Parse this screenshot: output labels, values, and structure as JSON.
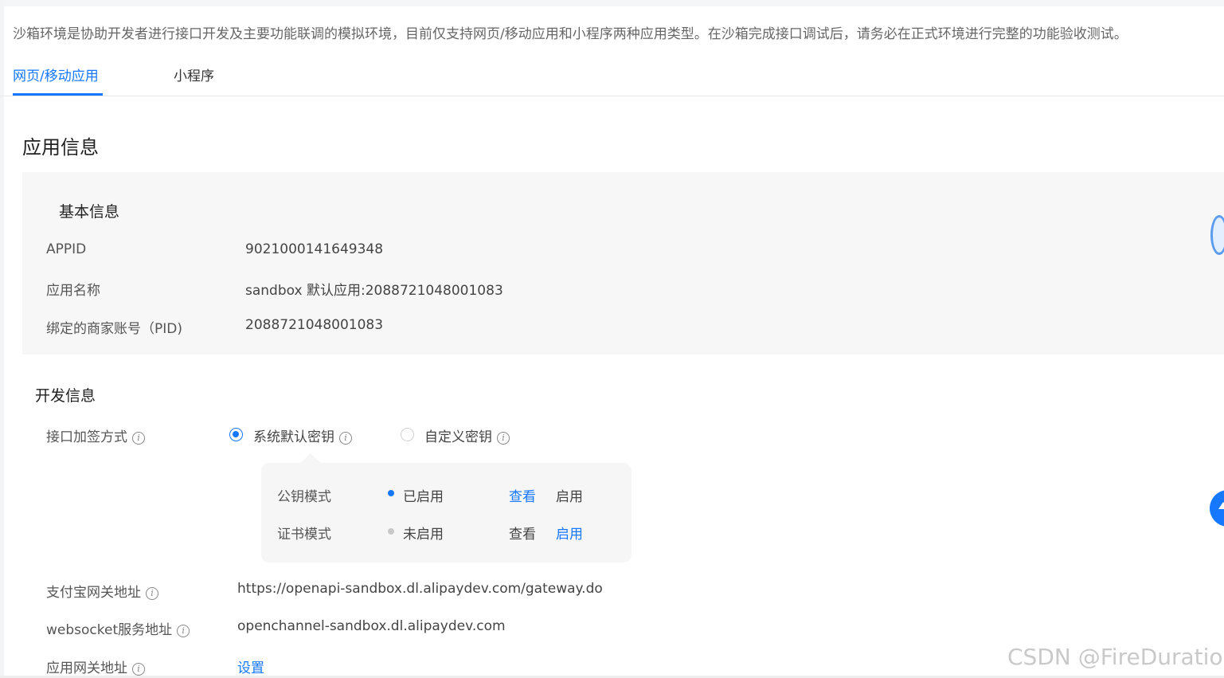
{
  "notice": "沙箱环境是协助开发者进行接口开发及主要功能联调的模拟环境，目前仅支持网页/移动应用和小程序两种应用类型。在沙箱完成接口调试后，请务必在正式环境进行完整的功能验收测试。",
  "tabs": [
    "网页/移动应用",
    "小程序"
  ],
  "app_info": {
    "title": "应用信息",
    "basic": {
      "title": "基本信息",
      "rows": [
        {
          "label": "APPID",
          "value": "9021000141649348"
        },
        {
          "label": "应用名称",
          "value": "sandbox 默认应用:2088721048001083"
        },
        {
          "label": "绑定的商家账号（PID)",
          "value": "2088721048001083"
        }
      ]
    }
  },
  "dev_info": {
    "title": "开发信息",
    "sign_method": {
      "label": "接口加签方式",
      "options": [
        {
          "label": "系统默认密钥",
          "checked": true
        },
        {
          "label": "自定义密钥",
          "checked": false
        }
      ]
    },
    "key_modes": [
      {
        "name": "公钥模式",
        "status": "已启用",
        "status_color": "#1677ff",
        "view": "查看",
        "enable": "启用"
      },
      {
        "name": "证书模式",
        "status": "未启用",
        "status_color": "#c8c8c8",
        "view": "查看",
        "enable": "启用"
      }
    ],
    "gateway": {
      "label": "支付宝网关地址",
      "value": "https://openapi-sandbox.dl.alipaydev.com/gateway.do"
    },
    "websocket": {
      "label": "websocket服务地址",
      "value": "openchannel-sandbox.dl.alipaydev.com"
    },
    "app_gateway": {
      "label": "应用网关地址",
      "value": "设置"
    }
  },
  "watermark": "CSDN @FireDuration",
  "colors": {
    "accent": "#1677ff",
    "panel": "#f7f7f8"
  }
}
